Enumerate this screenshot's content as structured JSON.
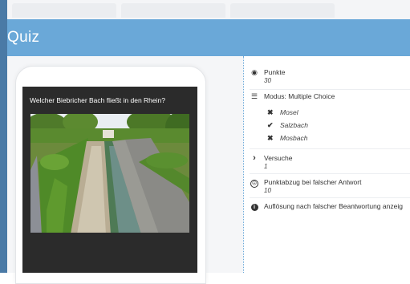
{
  "header": {
    "title": "Quiz"
  },
  "question": {
    "text": "Welcher Biebricher Bach fließt in den Rhein?"
  },
  "details": {
    "points_label": "Punkte",
    "points_value": "30",
    "mode_label": "Modus: Multiple Choice",
    "options": [
      {
        "text": "Mosel",
        "correct": false
      },
      {
        "text": "Salzbach",
        "correct": true
      },
      {
        "text": "Mosbach",
        "correct": false
      }
    ],
    "attempts_label": "Versuche",
    "attempts_value": "1",
    "deduction_label": "Punktabzug bei falscher Antwort",
    "deduction_value": "10",
    "resolution_label": "Auflösung nach falscher Beantwortung anzeig"
  },
  "icons": {
    "points": "piggy-bank-icon",
    "mode": "list-icon",
    "wrong": "x-mark-icon",
    "right": "check-mark-icon",
    "attempts": "chevron-right-icon",
    "deduction": "frown-icon",
    "resolution": "info-icon"
  },
  "colors": {
    "header": "#6aa8d8",
    "frame": "#4a7aa6",
    "screen": "#2b2b2b"
  }
}
